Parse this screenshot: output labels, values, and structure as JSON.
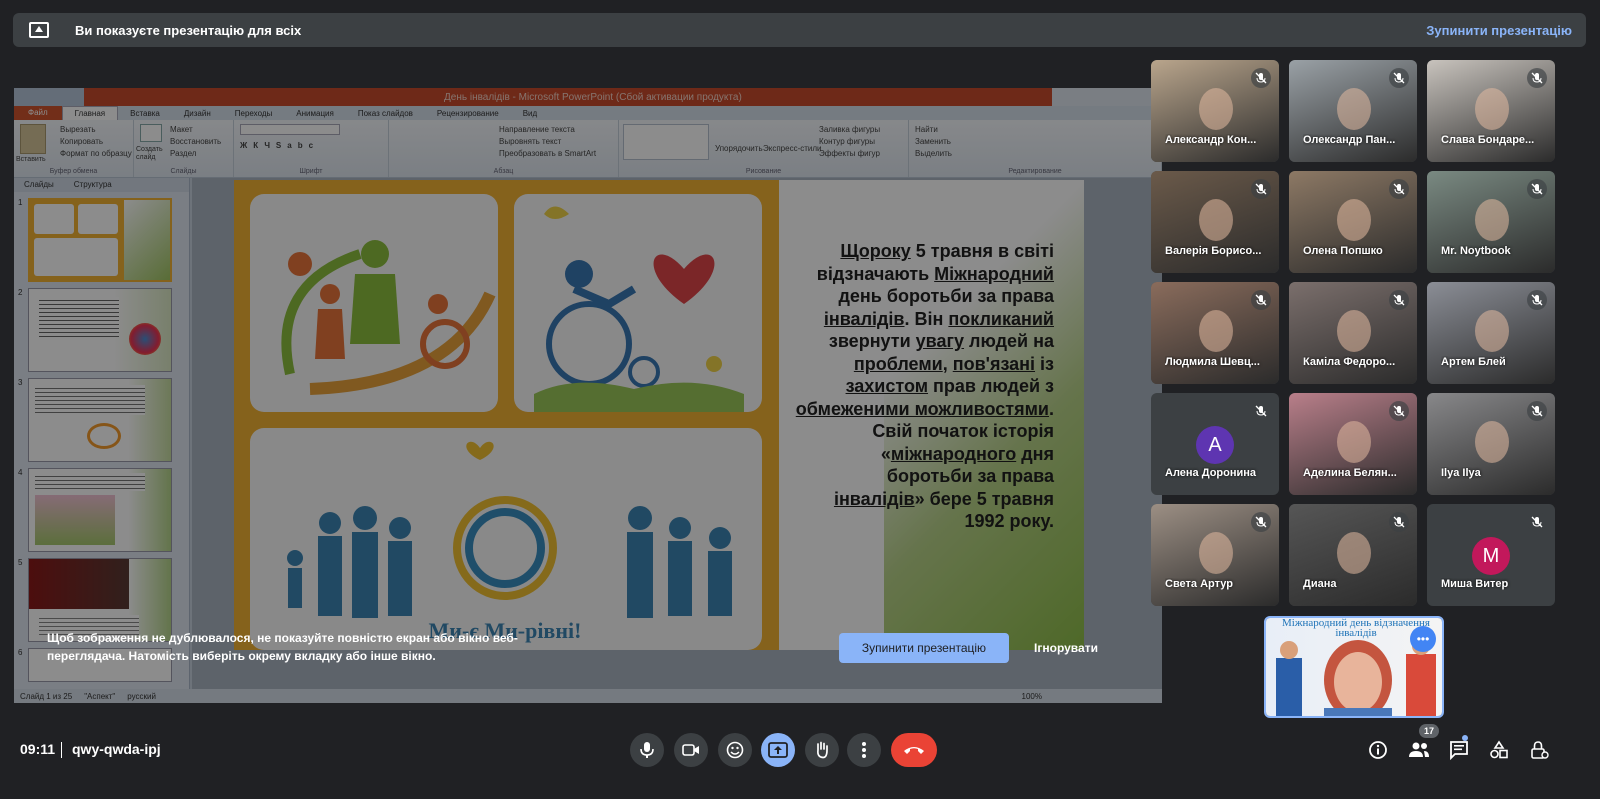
{
  "banner": {
    "message": "Ви показуєте презентацію для всіх",
    "stop_label": "Зупинити презентацію"
  },
  "ppt": {
    "title": "День інвалідів - Microsoft PowerPoint (Сбой активации продукта)",
    "tabs": [
      "Файл",
      "Главная",
      "Вставка",
      "Дизайн",
      "Переходы",
      "Анимация",
      "Показ слайдов",
      "Рецензирование",
      "Вид"
    ],
    "ribbon": {
      "clipboard": [
        "Вырезать",
        "Копировать",
        "Формат по образцу"
      ],
      "paste": "Вставить",
      "clipboard_label": "Буфер обмена",
      "slides": [
        "Макет",
        "Восстановить",
        "Раздел"
      ],
      "new_slide": "Создать слайд",
      "slides_label": "Слайды",
      "font_label": "Шрифт",
      "paragraph": [
        "Направление текста",
        "Выровнять текст",
        "Преобразовать в SmartArt"
      ],
      "paragraph_label": "Абзац",
      "drawing": [
        "Упорядочить",
        "Экспресс-стили",
        "Заливка фигуры",
        "Контур фигуры",
        "Эффекты фигур"
      ],
      "drawing_label": "Рисование",
      "editing": [
        "Найти",
        "Заменить",
        "Выделить"
      ],
      "editing_label": "Редактирование"
    },
    "panel_tabs": [
      "Слайды",
      "Структура"
    ],
    "slide_numbers": [
      "1",
      "2",
      "3",
      "4",
      "5",
      "6"
    ],
    "status": [
      "Слайд 1 из 25",
      "\"Аспект\"",
      "русский"
    ],
    "zoom": "100%",
    "slide_text_parts": [
      "Щороку",
      " 5 травня в світі відзначають ",
      "Міжнародний",
      " день боротьби за права ",
      "інвалідів",
      ". Він ",
      "покликаний",
      " звернути ",
      "увагу",
      " людей на ",
      "проблеми",
      ", ",
      "пов'язані",
      " із ",
      "захистом",
      " прав людей з ",
      "обмеженими можливостями",
      ". Свій початок історія «",
      "міжнародного",
      " дня боротьби за права ",
      "інвалідів",
      "» бере 5 травня 1992 року."
    ],
    "slide_logo_text": "Ми-є Ми-рівні!"
  },
  "overlay": {
    "warning": "Щоб зображення не дублювалося, не показуйте повністю екран або вікно веб-переглядача. Натомість виберіть окрему вкладку або інше вікно.",
    "stop_label": "Зупинити презентацію",
    "ignore_label": "Ігнорувати"
  },
  "participants": [
    {
      "name": "Александр Кон...",
      "color": "#b9a58c"
    },
    {
      "name": "Олександр Пан...",
      "color": "#9aa1a6"
    },
    {
      "name": "Слава Бондаре...",
      "color": "#c8c3bd"
    },
    {
      "name": "Валерія Борисо...",
      "color": "#6b5a4a"
    },
    {
      "name": "Олена Попшко",
      "color": "#8d7965"
    },
    {
      "name": "Mr. Noytbook",
      "color": "#7a8a82"
    },
    {
      "name": "Людмила Шевц...",
      "color": "#8a6c5c"
    },
    {
      "name": "Каміла Федоро...",
      "color": "#7b6f6c"
    },
    {
      "name": "Артем Блей",
      "color": "#8b8e96"
    },
    {
      "name": "Алена Доронина",
      "avatar": "A",
      "avatar_color": "#5e35b1"
    },
    {
      "name": "Аделина Белян...",
      "color": "#b97f8a"
    },
    {
      "name": "Ilya Ilya",
      "color": "#88888a"
    },
    {
      "name": "Света Артур",
      "color": "#9c8f84"
    },
    {
      "name": "Диана",
      "color": "#565656"
    },
    {
      "name": "Миша Витер",
      "avatar": "M",
      "avatar_color": "#c2185b"
    }
  ],
  "self_tile": {
    "caption": "Міжнародний день відзначення інвалідів"
  },
  "bottom": {
    "time": "09:11",
    "meeting_code": "qwy-qwda-ipj",
    "participant_count": "17"
  },
  "icons": {
    "mic": "mic-icon",
    "camera": "camera-icon",
    "emoji": "emoji-icon",
    "present": "present-icon",
    "hand": "raise-hand-icon",
    "more": "more-vert-icon",
    "end": "end-call-icon",
    "info": "info-icon",
    "people": "people-icon",
    "chat": "chat-icon",
    "activities": "activities-icon",
    "lock": "host-controls-icon"
  },
  "colors": {
    "accent": "#8ab4f8",
    "end_call": "#ea4335",
    "background": "#202124"
  }
}
